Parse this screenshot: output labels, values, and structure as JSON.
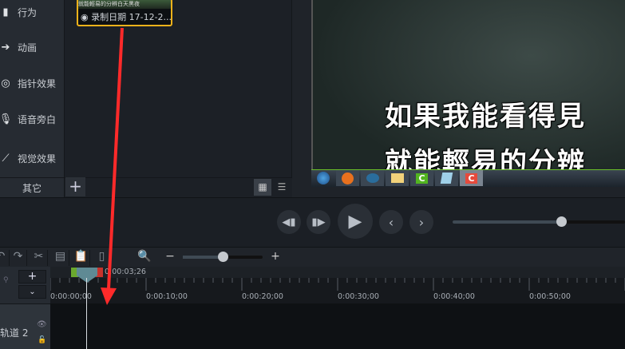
{
  "sidebar": {
    "items": [
      {
        "label": "行为",
        "icon": "behavior-icon"
      },
      {
        "label": "动画",
        "icon": "animation-icon"
      },
      {
        "label": "指针效果",
        "icon": "cursor-effect-icon"
      },
      {
        "label": "语音旁白",
        "icon": "microphone-icon"
      },
      {
        "label": "视觉效果",
        "icon": "magic-wand-icon"
      }
    ],
    "others": "其它",
    "add": "+"
  },
  "media": {
    "thumb_text": "就能輕易的分辨白天黑夜",
    "caption": "录制日期 17-12-2..."
  },
  "preview": {
    "line1": "如果我能看得見",
    "line2": "就能輕易的分辨"
  },
  "controls": {
    "scrub_progress": 0.63
  },
  "timeline": {
    "zoom_level": 0.5,
    "playhead_time": "0:00:03;26",
    "ticks": [
      "0:00:00;00",
      "0:00:10;00",
      "0:00:20;00",
      "0:00:30;00",
      "0:00:40;00",
      "0:00:50;00"
    ],
    "track": "轨道 2",
    "add": "+",
    "minus": "−",
    "plus": "+"
  },
  "colors": {
    "accent": "#f0b21a",
    "arrow": "#ff2a2a"
  }
}
